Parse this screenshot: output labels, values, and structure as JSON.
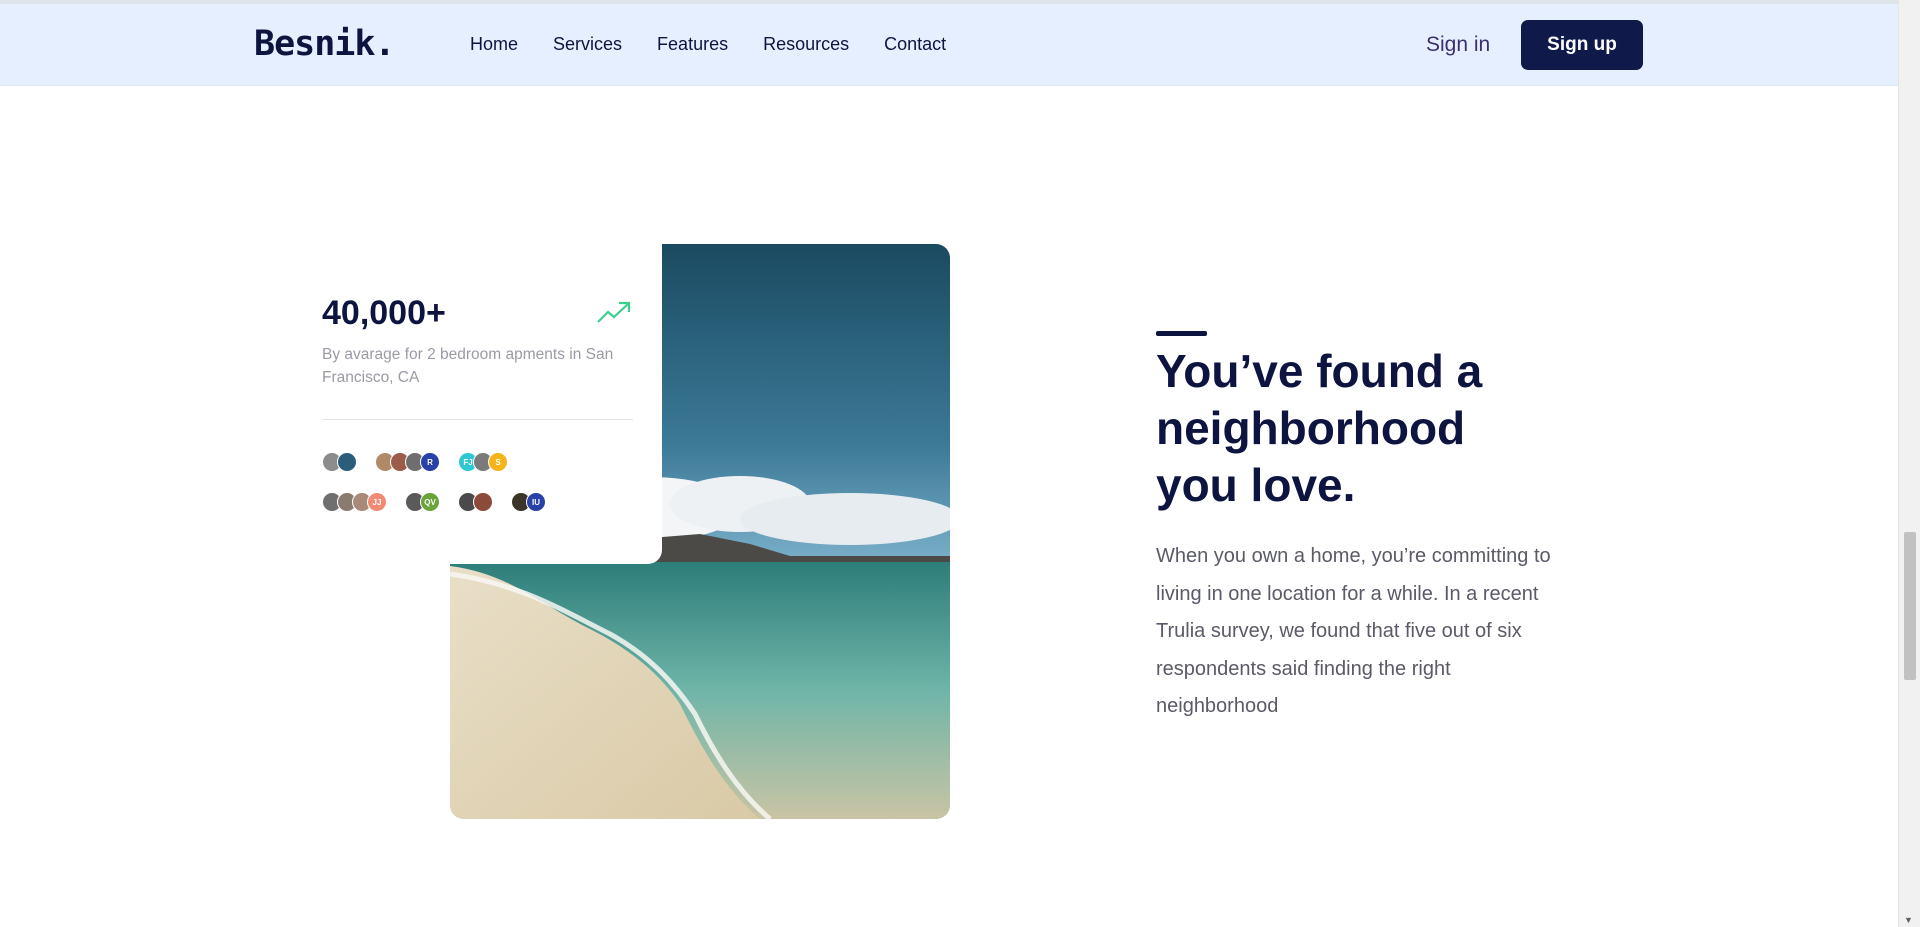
{
  "nav": {
    "logo": "Besnik.",
    "links": [
      "Home",
      "Services",
      "Features",
      "Resources",
      "Contact"
    ],
    "sign_in": "Sign in",
    "sign_up": "Sign up"
  },
  "stats": {
    "number": "40,000+",
    "caption": "By avarage for 2 bedroom apments in San Francisco, CA",
    "trend_icon": "trending-up-icon",
    "trend_color": "#3ecf8e",
    "avatar_rows": [
      [
        [
          {
            "initials": "",
            "color": "#8c8c8c"
          },
          {
            "initials": "",
            "color": "#2a5d7a"
          }
        ],
        [
          {
            "initials": "",
            "color": "#b08a66"
          },
          {
            "initials": "",
            "color": "#9b5c4a"
          },
          {
            "initials": "",
            "color": "#6e6e6e"
          },
          {
            "initials": "R",
            "color": "#2741a8"
          }
        ],
        [
          {
            "initials": "FJ",
            "color": "#2ec7d3"
          },
          {
            "initials": "",
            "color": "#7a7a7a"
          },
          {
            "initials": "S",
            "color": "#f4b41a"
          }
        ]
      ],
      [
        [
          {
            "initials": "",
            "color": "#6f6f6f"
          },
          {
            "initials": "",
            "color": "#8a7b70"
          },
          {
            "initials": "",
            "color": "#a88a78"
          },
          {
            "initials": "JJ",
            "color": "#f08a72"
          }
        ],
        [
          {
            "initials": "",
            "color": "#5a5a5a"
          },
          {
            "initials": "QV",
            "color": "#6aa33a"
          }
        ],
        [
          {
            "initials": "",
            "color": "#4a4a4a"
          },
          {
            "initials": "",
            "color": "#8b4a3a"
          }
        ],
        [
          {
            "initials": "",
            "color": "#3a3528"
          },
          {
            "initials": "IU",
            "color": "#2741a8"
          }
        ]
      ]
    ]
  },
  "section": {
    "headline": "You’ve found a neighborhood you love.",
    "body": "When you own a home, you’re committing to living in one location for a while. In a recent Trulia survey, we found that five out of six respondents said finding the right neighborhood"
  },
  "colors": {
    "navy": "#0d1440",
    "nav_bg": "#e6efff",
    "button_bg": "#0f1a4a"
  }
}
